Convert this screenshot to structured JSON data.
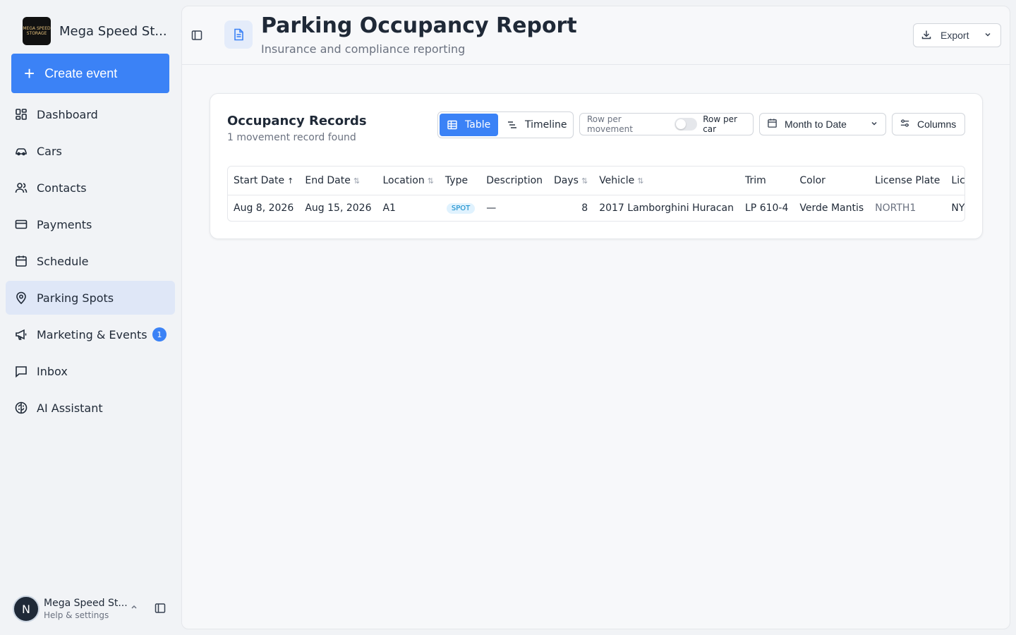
{
  "brand": {
    "name": "Mega Speed St...",
    "logo_text": "MEGA SPEED STORAGE"
  },
  "sidebar": {
    "create_label": "Create event",
    "items": [
      {
        "label": "Dashboard",
        "icon": "dashboard-icon"
      },
      {
        "label": "Cars",
        "icon": "car-icon"
      },
      {
        "label": "Contacts",
        "icon": "users-icon"
      },
      {
        "label": "Payments",
        "icon": "credit-card-icon"
      },
      {
        "label": "Schedule",
        "icon": "calendar-icon"
      },
      {
        "label": "Parking Spots",
        "icon": "map-pin-icon",
        "active": true
      },
      {
        "label": "Marketing & Events",
        "icon": "megaphone-icon",
        "badge": "1"
      },
      {
        "label": "Inbox",
        "icon": "message-icon"
      },
      {
        "label": "AI Assistant",
        "icon": "brain-icon"
      }
    ]
  },
  "user": {
    "initial": "N",
    "name": "Mega Speed St...",
    "sub": "Help & settings"
  },
  "header": {
    "title": "Parking Occupancy Report",
    "subtitle": "Insurance and compliance reporting",
    "export_label": "Export"
  },
  "card": {
    "title": "Occupancy Records",
    "subtitle": "1 movement record found",
    "view_table": "Table",
    "view_timeline": "Timeline",
    "toggle_off_label": "Row per movement",
    "toggle_on_label": "Row per car",
    "date_range": "Month to Date",
    "columns_label": "Columns"
  },
  "table": {
    "headers": [
      "Start Date",
      "End Date",
      "Location",
      "Type",
      "Description",
      "Days",
      "Vehicle",
      "Trim",
      "Color",
      "License Plate",
      "License Pl"
    ],
    "rows": [
      {
        "start_date": "Aug 8, 2026",
        "end_date": "Aug 15, 2026",
        "location": "A1",
        "type": "SPOT",
        "description": "—",
        "days": "8",
        "vehicle": "2017 Lamborghini Huracan",
        "trim": "LP 610-4",
        "color": "Verde Mantis",
        "license_plate": "NORTH1",
        "license_state": "NY"
      }
    ]
  },
  "colors": {
    "accent": "#3b82f6",
    "active_nav": "#dfe7f7",
    "pill_bg": "#e0f2fe",
    "pill_text": "#0284c7"
  }
}
